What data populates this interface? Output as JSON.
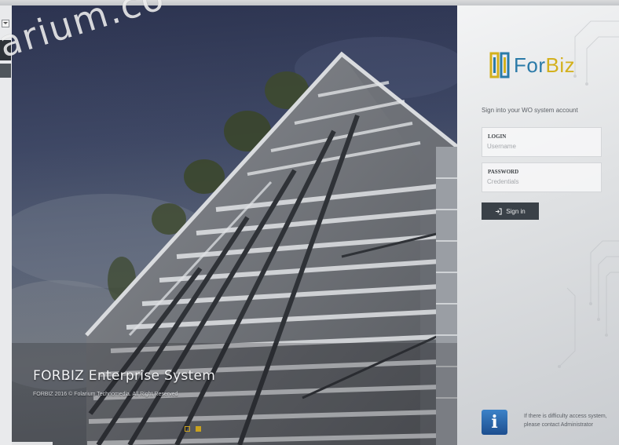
{
  "hero": {
    "title": "FORBIZ Enterprise System",
    "copyright": "FORBIZ 2016 © Folarium Technomedia. All Right Reserved",
    "slides": [
      {
        "active": false
      },
      {
        "active": true
      }
    ]
  },
  "brand": {
    "logo_prefix": "For",
    "logo_suffix": "Biz",
    "logo_icon": "forbiz-logo-icon"
  },
  "login": {
    "subtitle": "Sign into your WO system account",
    "login_label": "LOGIN",
    "login_placeholder": "Username",
    "password_label": "PASSWORD",
    "password_placeholder": "Credentials",
    "signin_label": "Sign in",
    "signin_icon": "sign-in-icon"
  },
  "help": {
    "icon": "info-icon",
    "line1": "If there is difficulty access system,",
    "line2": "please contact Administrator"
  },
  "watermark": "arium.co",
  "colors": {
    "brand_blue": "#2a7aa8",
    "brand_gold": "#d3b01d",
    "button_dark": "#3a4148",
    "info_blue": "#1d4e8f"
  }
}
